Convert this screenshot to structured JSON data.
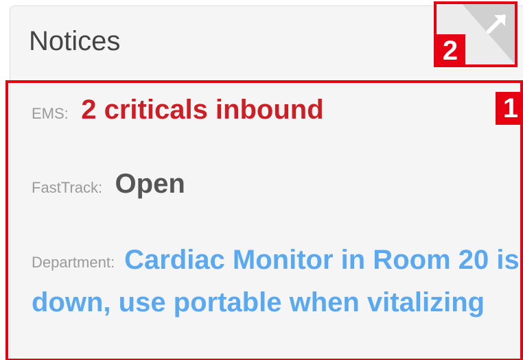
{
  "panel": {
    "title": "Notices",
    "expand_icon": "expand-arrow-icon"
  },
  "annotations": {
    "box1": "1",
    "box2": "2"
  },
  "notices": {
    "ems": {
      "label": "EMS:",
      "value": "2 criticals inbound",
      "color": "#cc1f25"
    },
    "fasttrack": {
      "label": "FastTrack:",
      "value": "Open",
      "color": "#555555"
    },
    "department": {
      "label": "Department:",
      "value": "Cardiac Monitor in Room 20 is down, use portable when vitalizing",
      "color": "#5aa9f0"
    }
  }
}
